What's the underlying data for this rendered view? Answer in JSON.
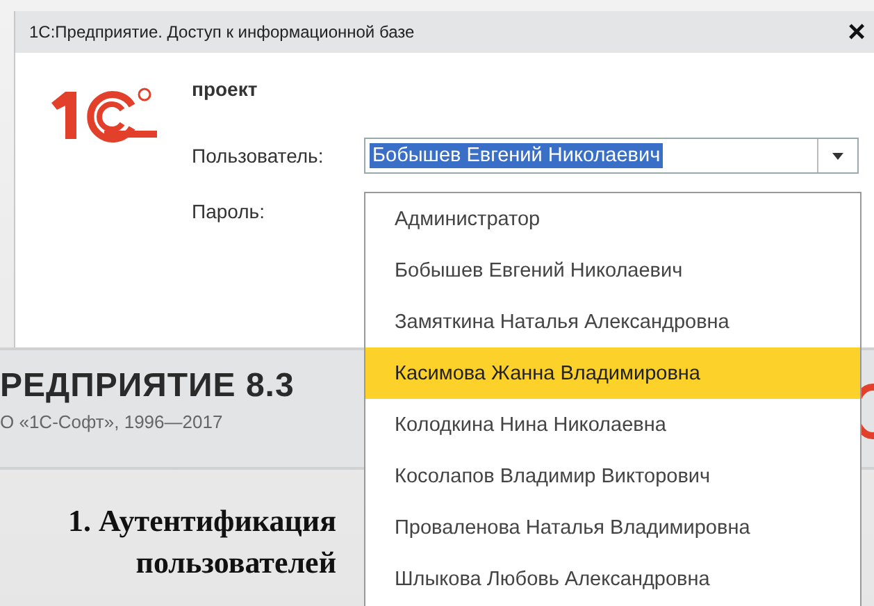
{
  "window": {
    "title": "1С:Предприятие. Доступ к информационной базе",
    "close": "×"
  },
  "infobase": "проект",
  "user_label": "Пользователь:",
  "user_field": {
    "value": "Бобышев Евгений Николаевич",
    "expanded": true
  },
  "password_label": "Пароль:",
  "user_list": [
    {
      "name": "Администратор",
      "selected": false
    },
    {
      "name": "Бобышев Евгений Николаевич",
      "selected": false
    },
    {
      "name": "Замяткина Наталья Александровна",
      "selected": false
    },
    {
      "name": "Касимова Жанна Владимировна",
      "selected": true
    },
    {
      "name": "Колодкина Нина Николаевна",
      "selected": false
    },
    {
      "name": "Косолапов Владимир Викторович",
      "selected": false
    },
    {
      "name": "Проваленова Наталья Владимировна",
      "selected": false
    },
    {
      "name": "Шлыкова Любовь Александровна",
      "selected": false
    }
  ],
  "banner": {
    "product": "РЕДПРИЯТИЕ 8.3",
    "copyright": "О «1С-Софт», 1996—2017"
  },
  "caption": [
    "1. Аутентификация",
    "пользователей"
  ]
}
